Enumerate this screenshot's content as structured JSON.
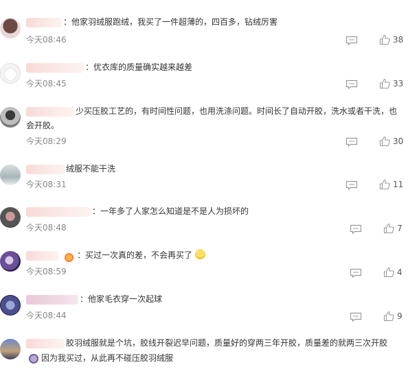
{
  "comments": [
    {
      "text": "：他家羽绒服跑绒，我买了一件超薄的，四百多，钻绒厉害",
      "time": "今天08:46",
      "likes": "38"
    },
    {
      "text": "：优衣库的质量确实越来越差",
      "time": "今天08:45",
      "likes": "33"
    },
    {
      "text": "少买压胶工艺的，有时间性问题，也用洗涤问题。时间长了自动开胶，洗水或者干洗，也会开胶。",
      "time": "今天08:29",
      "likes": "30"
    },
    {
      "text": "绒服不能干洗",
      "time": "今天08:31",
      "likes": "11"
    },
    {
      "text": "：一年多了人家怎么知道是不是人为损坏的",
      "time": "今天08:48",
      "likes": "7"
    },
    {
      "text": "：买过一次真的差，不会再买了",
      "time": "今天08:59",
      "likes": "4"
    },
    {
      "text": "：他家毛衣穿一次起球",
      "time": "今天08:44",
      "likes": "9"
    },
    {
      "text": "胶羽绒服就是个坑，胶线开裂迟早问题，质量好的穿两三年开胶，质量差的就两三次开胶",
      "reply_text": "因为我买过，从此再不碰压胶羽绒服"
    }
  ],
  "icons": {
    "reply": "comment-icon",
    "like": "thumbs-up-icon"
  }
}
